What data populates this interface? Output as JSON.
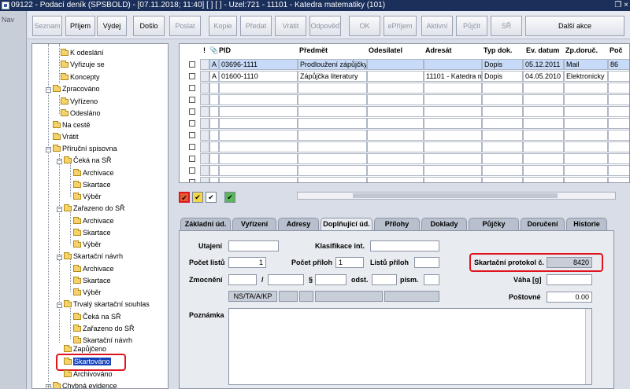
{
  "window": {
    "title": "09122 - Podací deník (SPSBOLD) - [07.11.2018; 11:40] [ ] [ ] - Uzel:721 - 11101 - Katedra matematiky (101)",
    "controls": "❐ ×"
  },
  "left_strip": {
    "nav_label": "Nav"
  },
  "toolbar": {
    "buttons": [
      {
        "label": "Seznam",
        "enabled": false
      },
      {
        "label": "Příjem",
        "enabled": true
      },
      {
        "label": "Výdej",
        "enabled": true
      },
      {
        "label": "Došlo",
        "enabled": true
      },
      {
        "label": "Poslat",
        "enabled": false
      },
      {
        "label": "Kopie",
        "enabled": false
      },
      {
        "label": "Předat",
        "enabled": false
      },
      {
        "label": "Vrátit",
        "enabled": false
      },
      {
        "label": "Odpověď",
        "enabled": false
      },
      {
        "label": "OK",
        "enabled": false
      },
      {
        "label": "ePříjem",
        "enabled": false
      },
      {
        "label": "Aktivní",
        "enabled": false
      },
      {
        "label": "Půjčit",
        "enabled": false
      },
      {
        "label": "SŘ",
        "enabled": false
      },
      {
        "label": "Další akce",
        "enabled": true
      }
    ]
  },
  "tree": {
    "items": [
      {
        "label": "K odeslání"
      },
      {
        "label": "Vyřizuje se"
      },
      {
        "label": "Koncepty"
      },
      {
        "label": "Zpracováno"
      },
      {
        "label": "Vyřízeno"
      },
      {
        "label": "Odesláno"
      },
      {
        "label": "Na cestě"
      },
      {
        "label": "Vrátit"
      },
      {
        "label": "Příruční spisovna"
      },
      {
        "label": "Čeká na SŘ"
      },
      {
        "label": "Archivace"
      },
      {
        "label": "Skartace"
      },
      {
        "label": "Výběr"
      },
      {
        "label": "Zařazeno do SŘ"
      },
      {
        "label": "Archivace"
      },
      {
        "label": "Skartace"
      },
      {
        "label": "Výběr"
      },
      {
        "label": "Skartační návrh"
      },
      {
        "label": "Archivace"
      },
      {
        "label": "Skartace"
      },
      {
        "label": "Výběr"
      },
      {
        "label": "Trvalý skartační souhlas"
      },
      {
        "label": "Čeká na SŘ"
      },
      {
        "label": "Zařazeno do SŘ"
      },
      {
        "label": "Skartační návrh"
      },
      {
        "label": "Zapůjčeno"
      },
      {
        "label": "Skartováno",
        "selected": true
      },
      {
        "label": "Archivováno"
      },
      {
        "label": "Chybná evidence"
      }
    ]
  },
  "grid": {
    "headers": {
      "flag": "!",
      "attach": "📎",
      "pid": "PID",
      "subject": "Předmět",
      "sender": "Odesílatel",
      "addressee": "Adresát",
      "doc_type": "Typ dok.",
      "registered": "Ev. datum",
      "delivery": "Zp.doruč.",
      "extra": "Poč"
    },
    "rows": [
      {
        "flag": "A",
        "pid": "03696-1111",
        "subject": "Prodloužení zápůjčky",
        "sender": "",
        "addressee": "",
        "doc_type": "Dopis",
        "registered": "05.12.2011",
        "delivery": "Mail",
        "extra": "86"
      },
      {
        "flag": "A",
        "pid": "01600-1110",
        "subject": "Zápůjčka literatury",
        "sender": "",
        "addressee": "11101 - Katedra m",
        "doc_type": "Dopis",
        "registered": "04.05.2010",
        "delivery": "Elektronicky",
        "extra": ""
      }
    ],
    "filters": [
      "✔",
      "✔",
      "✔",
      "✔"
    ],
    "filter_colors": [
      "#e55b2e",
      "#f2d64b",
      "#ffffff",
      "#5ab85a"
    ]
  },
  "tabs": [
    {
      "label": "Základní úd."
    },
    {
      "label": "Vyřízení"
    },
    {
      "label": "Adresy"
    },
    {
      "label": "Doplňující úd.",
      "active": true
    },
    {
      "label": "Přílohy"
    },
    {
      "label": "Doklady"
    },
    {
      "label": "Půjčky"
    },
    {
      "label": "Doručení"
    },
    {
      "label": "Historie"
    }
  ],
  "form": {
    "utajeni_label": "Utajení",
    "utajeni_value": "",
    "klasifikace_label": "Klasifikace int.",
    "klasifikace_value": "",
    "pocet_listu_label": "Počet listů",
    "pocet_listu_value": "1",
    "pocet_priloh_label": "Počet příloh",
    "pocet_priloh_value": "1",
    "listu_priloh_label": "Listů příloh",
    "listu_priloh_value": "",
    "skartacni_label": "Skartační protokol č.",
    "skartacni_value": "8420",
    "zmocneni_label": "Zmocnění",
    "slash": "/",
    "paragraph": "§",
    "odst_label": "odst.",
    "pism_label": "písm.",
    "vaha_label": "Váha [g]",
    "vaha_value": "",
    "ns_button": "NS/TA/A/KP",
    "postovne_label": "Poštovné",
    "postovne_value": "0.00",
    "poznamka_label": "Poznámka",
    "poznamka_value": ""
  }
}
